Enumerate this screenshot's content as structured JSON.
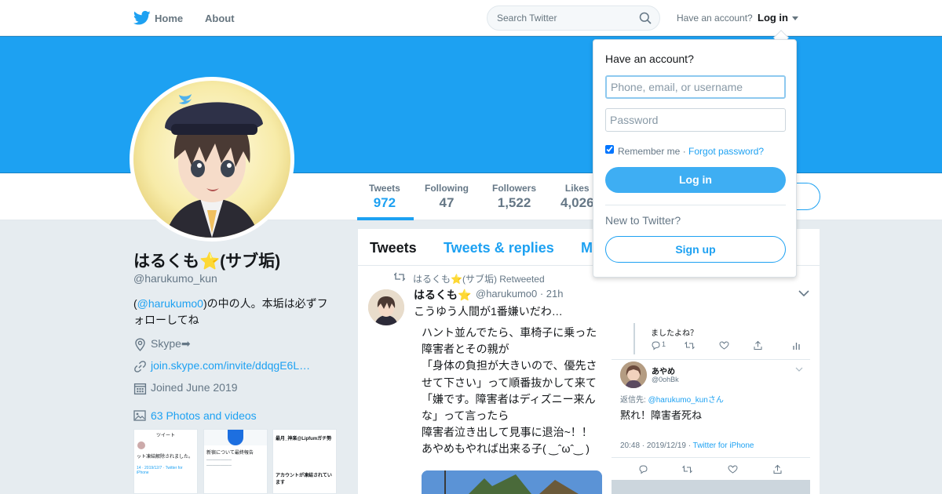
{
  "nav": {
    "home": "Home",
    "about": "About",
    "search_placeholder": "Search Twitter",
    "have_account": "Have an account?",
    "login": "Log in"
  },
  "colors": {
    "accent": "#1da1f2",
    "banner": "#1da1f2",
    "background": "#e6ecf0"
  },
  "profile": {
    "display_name": "はるくも⭐(サブ垢)",
    "handle": "@harukumo_kun",
    "bio_prefix": "(",
    "bio_mention": "@harukumo0",
    "bio_suffix": ")の中の人。本垢は必ずフォローしてね",
    "location": "Skype➡",
    "url": "join.skype.com/invite/ddqgE6L…",
    "joined": "Joined June 2019",
    "photos": "63 Photos and videos"
  },
  "stats": [
    {
      "label": "Tweets",
      "value": "972"
    },
    {
      "label": "Following",
      "value": "47"
    },
    {
      "label": "Followers",
      "value": "1,522"
    },
    {
      "label": "Likes",
      "value": "4,026"
    }
  ],
  "timeline": {
    "tabs": [
      "Tweets",
      "Tweets & replies",
      "M"
    ],
    "tweet": {
      "retweet_line": "はるくも⭐(サブ垢) Retweeted",
      "name": "はるくも⭐",
      "handle_time": "@harukumo0 · 21h",
      "text": "こうゆう人間が1番嫌いだわ…",
      "body": [
        "ハント並んでたら、車椅子に乗った",
        "障害者とその親が",
        "「身体の負担が大きいので、優先さ",
        "せて下さい」って順番抜かして来て",
        "「嫌です。障害者はディズニー来ん",
        "な」って言ったら",
        "障害者泣き出して見事に退治~！！",
        "あやめもやれば出来る子( ‿ˆωˆ‿ )"
      ]
    },
    "embed": {
      "prev_text": "ましたよね？",
      "prev_count": "1",
      "name": "あやめ",
      "handle": "@0ohBk",
      "reply_to_label": "返信先: ",
      "reply_to_user": "@harukumo_kunさん",
      "text": "黙れ！障害者死ね",
      "time": "20:48 · 2019/12/19 · ",
      "source": "Twitter for iPhone"
    }
  },
  "login_dropdown": {
    "title": "Have an account?",
    "username_placeholder": "Phone, email, or username",
    "password_placeholder": "Password",
    "remember": "Remember me",
    "separator": " · ",
    "forgot": "Forgot password?",
    "login_button": "Log in",
    "new_to": "New to Twitter?",
    "signup": "Sign up"
  },
  "thumbnails": [
    {
      "title": "ツイート",
      "line": "ット凍結解除されました。",
      "footer": "14 · 2019/12/7 · Twitter for iPhone"
    },
    {
      "title": "",
      "line": "新宿について最終報告",
      "footer": ""
    },
    {
      "title": "最月_神楽@Lipfumガチ勢",
      "line": "アカウントが凍結されています",
      "footer": ""
    }
  ]
}
